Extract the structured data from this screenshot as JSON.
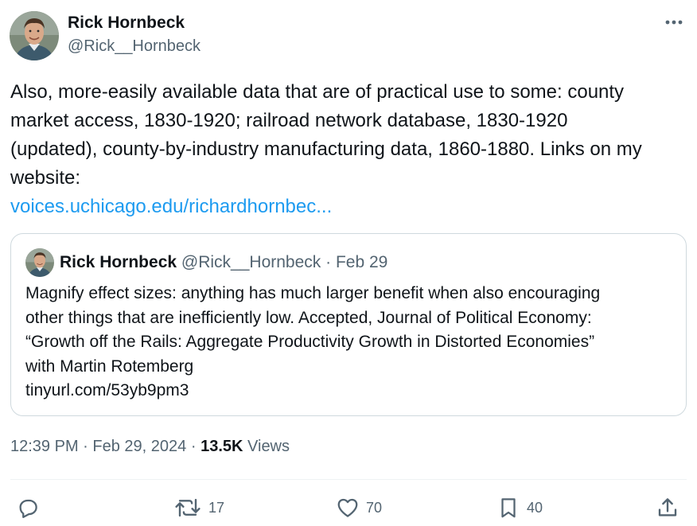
{
  "author": {
    "name": "Rick Hornbeck",
    "handle": "@Rick__Hornbeck",
    "avatar_icon": "profile-photo"
  },
  "more_icon": "ellipsis-icon",
  "tweet": {
    "lines": [
      "Also, more-easily available data that are of practical use to some: county",
      "market access, 1830-1920; railroad network database, 1830-1920",
      "(updated), county-by-industry manufacturing data, 1860-1880. Links on my",
      "website:"
    ],
    "link": "voices.uchicago.edu/richardhornbec..."
  },
  "quote": {
    "name": "Rick Hornbeck",
    "handle": "@Rick__Hornbeck",
    "separator": "·",
    "date": "Feb 29",
    "lines": [
      "Magnify effect sizes: anything has much larger benefit when also encouraging",
      "other things that are inefficiently low. Accepted, Journal of Political Economy:",
      "“Growth off the Rails: Aggregate Productivity Growth in Distorted Economies”",
      "with Martin Rotemberg",
      "tinyurl.com/53yb9pm3"
    ]
  },
  "meta": {
    "time": "12:39 PM",
    "sep1": "·",
    "date": "Feb 29, 2024",
    "sep2": "·",
    "views_count": "13.5K",
    "views_label": "Views"
  },
  "actions": {
    "reply": {
      "icon": "reply-icon",
      "count": ""
    },
    "retweet": {
      "icon": "retweet-icon",
      "count": "17"
    },
    "like": {
      "icon": "heart-icon",
      "count": "70"
    },
    "bookmark": {
      "icon": "bookmark-icon",
      "count": "40"
    },
    "share": {
      "icon": "share-icon",
      "count": ""
    }
  },
  "colors": {
    "text": "#0f1419",
    "secondary": "#536471",
    "link": "#1d9bf0",
    "border": "#cfd9de"
  }
}
